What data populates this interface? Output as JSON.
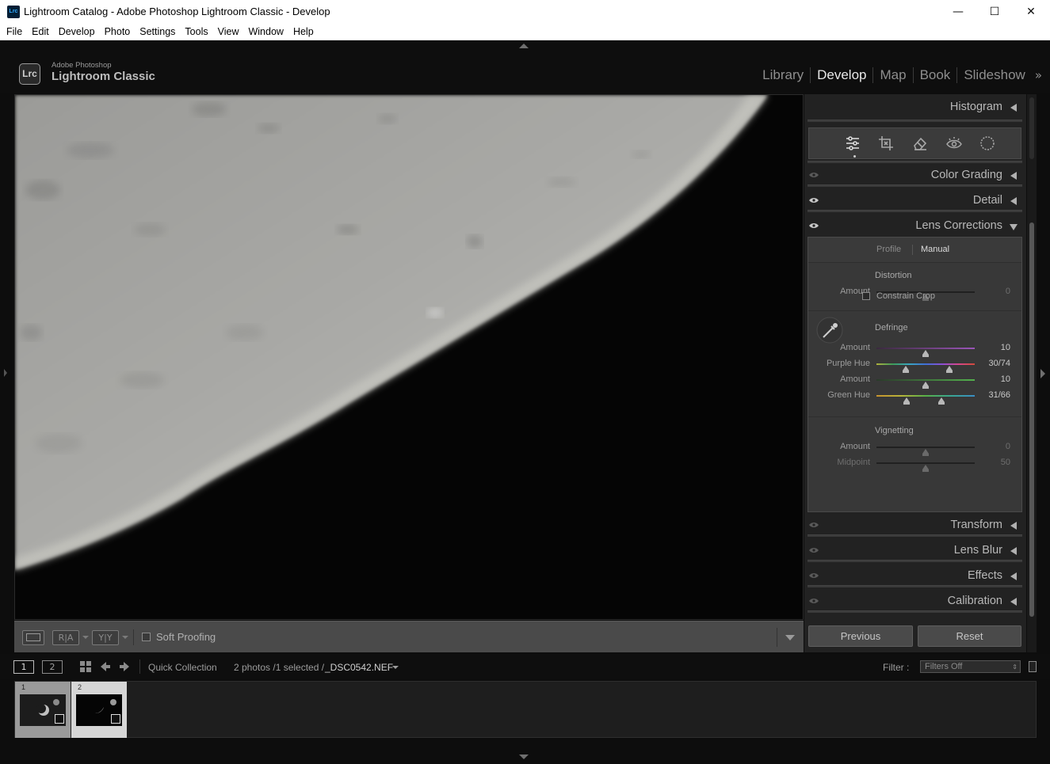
{
  "window": {
    "app_icon": "Lrc",
    "title": "Lightroom Catalog - Adobe Photoshop Lightroom Classic - Develop",
    "minimize": "—",
    "maximize": "☐",
    "close": "✕"
  },
  "menu": [
    "File",
    "Edit",
    "Develop",
    "Photo",
    "Settings",
    "Tools",
    "View",
    "Window",
    "Help"
  ],
  "brand": {
    "logo": "Lrc",
    "small": "Adobe Photoshop",
    "big": "Lightroom Classic"
  },
  "modules": {
    "items": [
      "Library",
      "Develop",
      "Map",
      "Book",
      "Slideshow"
    ],
    "active": "Develop",
    "more": "»"
  },
  "toolbar": {
    "view_compare_ra": "R|A",
    "view_compare_yy": "Y|Y",
    "soft_proofing_label": "Soft Proofing",
    "soft_proofing_checked": false
  },
  "panels": {
    "histogram": "Histogram",
    "color_grading": "Color Grading",
    "detail": "Detail",
    "lens_corrections": "Lens Corrections",
    "transform": "Transform",
    "lens_blur": "Lens Blur",
    "effects": "Effects",
    "calibration": "Calibration"
  },
  "tools": [
    "edit-sliders-icon",
    "crop-icon",
    "healing-eraser-icon",
    "red-eye-icon",
    "masking-icon"
  ],
  "lens": {
    "tabs": {
      "profile": "Profile",
      "manual": "Manual",
      "active": "Manual"
    },
    "distortion": {
      "title": "Distortion",
      "amount_label": "Amount",
      "amount_value": "0",
      "amount_norm": 0.5,
      "constrain_crop_label": "Constrain Crop",
      "constrain_crop_checked": false
    },
    "defringe": {
      "title": "Defringe",
      "purple_amount_label": "Amount",
      "purple_amount_value": "10",
      "purple_amount_norm": 0.5,
      "purple_hue_label": "Purple Hue",
      "purple_hue_value": "30/74",
      "purple_hue_low": 30,
      "purple_hue_high": 74,
      "green_amount_label": "Amount",
      "green_amount_value": "10",
      "green_amount_norm": 0.5,
      "green_hue_label": "Green Hue",
      "green_hue_value": "31/66",
      "green_hue_low": 31,
      "green_hue_high": 66
    },
    "vignetting": {
      "title": "Vignetting",
      "amount_label": "Amount",
      "amount_value": "0",
      "amount_norm": 0.5,
      "midpoint_label": "Midpoint",
      "midpoint_value": "50",
      "midpoint_norm": 0.5
    }
  },
  "buttons": {
    "previous": "Previous",
    "reset": "Reset"
  },
  "filmbar": {
    "screen1": "1",
    "screen2": "2",
    "source": "Quick Collection",
    "count": "2 photos /1 selected /",
    "filename": "_DSC0542.NEF",
    "filter_label": "Filter :",
    "filter_value": "Filters Off"
  },
  "filmstrip": [
    {
      "index": "1",
      "selected": false
    },
    {
      "index": "2",
      "selected": true
    }
  ],
  "colors": {
    "panel_bg": "#222222",
    "accent_text": "#e8e8e8",
    "moon_light": "#b9b9b6",
    "moon_dark": "#8f8f8c"
  }
}
